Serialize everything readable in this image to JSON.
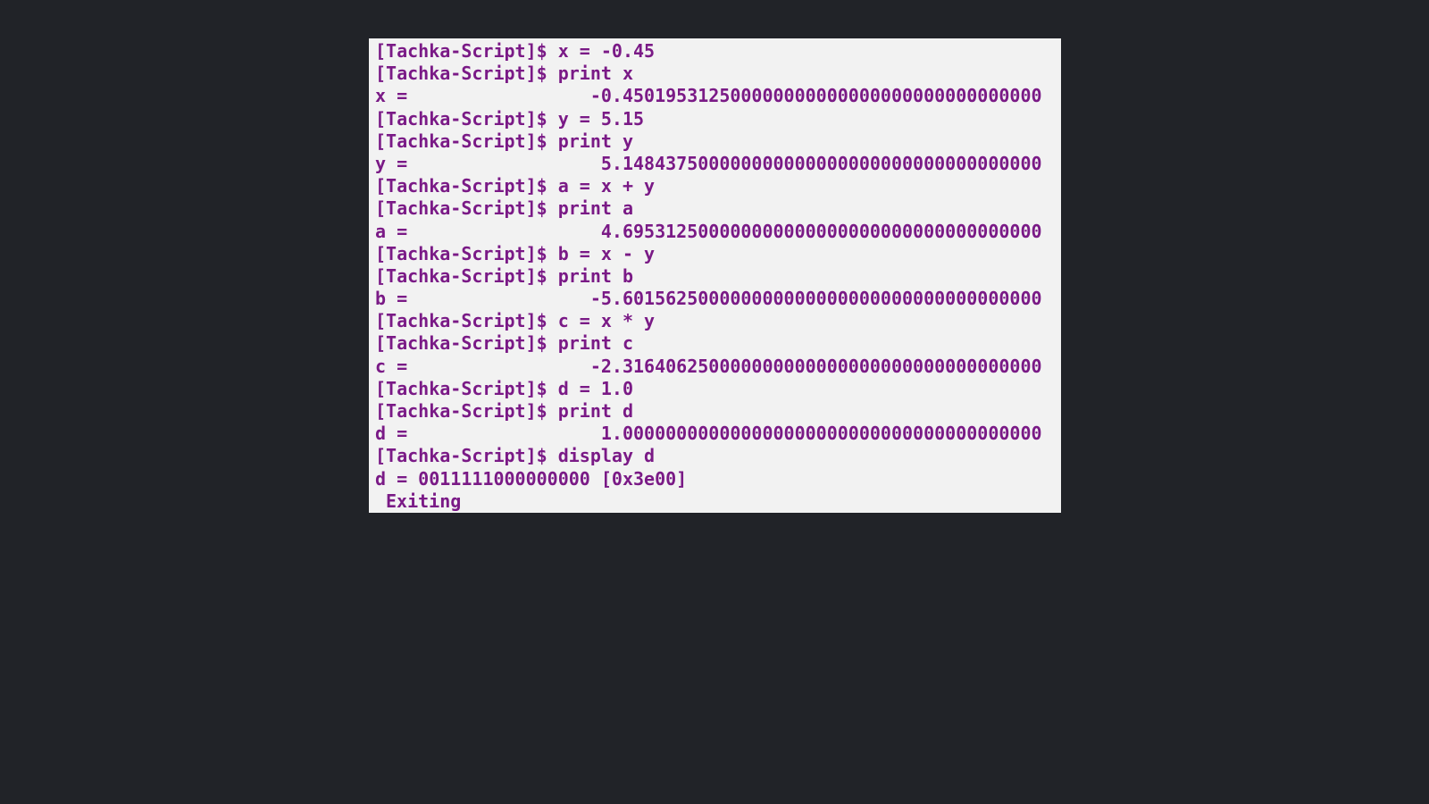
{
  "terminal": {
    "text_color": "#7a1a86",
    "background_color": "#f2f2f2",
    "lines": [
      "[Tachka-Script]$ x = -0.45",
      "[Tachka-Script]$ print x",
      "x =                 -0.450195312500000000000000000000000000000",
      "[Tachka-Script]$ y = 5.15",
      "[Tachka-Script]$ print y",
      "y =                  5.148437500000000000000000000000000000000",
      "[Tachka-Script]$ a = x + y",
      "[Tachka-Script]$ print a",
      "a =                  4.695312500000000000000000000000000000000",
      "[Tachka-Script]$ b = x - y",
      "[Tachka-Script]$ print b",
      "b =                 -5.601562500000000000000000000000000000000",
      "[Tachka-Script]$ c = x * y",
      "[Tachka-Script]$ print c",
      "c =                 -2.316406250000000000000000000000000000000",
      "[Tachka-Script]$ d = 1.0",
      "[Tachka-Script]$ print d",
      "d =                  1.000000000000000000000000000000000000000",
      "[Tachka-Script]$ display d",
      "d = 0011111000000000 [0x3e00]",
      "Exiting"
    ]
  }
}
